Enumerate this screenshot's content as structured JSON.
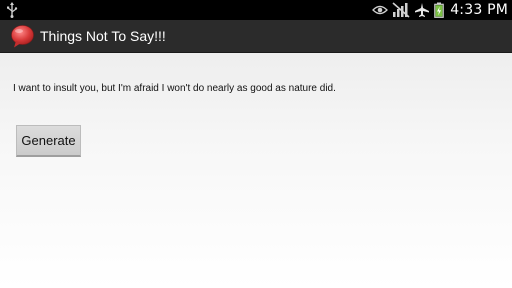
{
  "status_bar": {
    "time": "4:33 PM",
    "icons": [
      "usb-icon",
      "eye-icon",
      "no-signal-icon",
      "airplane-icon",
      "battery-charging-icon"
    ]
  },
  "action_bar": {
    "title": "Things Not To Say!!!",
    "app_icon": "speech-bubble-icon"
  },
  "main": {
    "insult_text": "I want to insult you, but I'm afraid I won't do nearly as good as nature did.",
    "generate_label": "Generate"
  },
  "colors": {
    "status_bar_bg": "#000000",
    "action_bar_bg": "#2b2b2b",
    "app_icon_red": "#d93a3a",
    "battery_green": "#7ac143"
  }
}
